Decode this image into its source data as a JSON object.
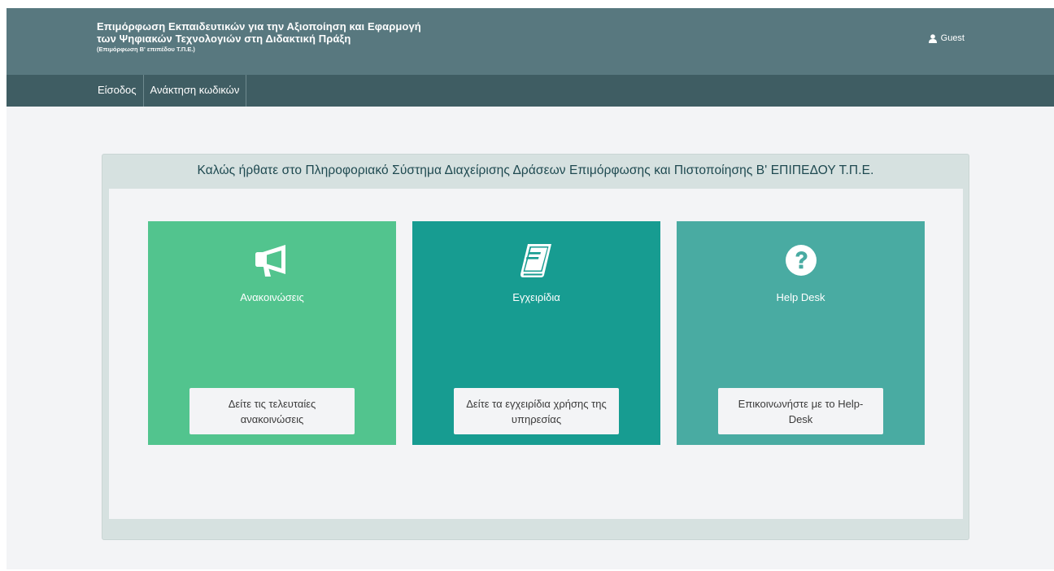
{
  "header": {
    "title_line1": "Επιμόρφωση Εκπαιδευτικών για την Αξιοποίηση και Εφαρμογή",
    "title_line2": "των Ψηφιακών Τεχνολογιών στη Διδακτική Πράξη",
    "subtitle": "(Επιμόρφωση Β' επιπέδου Τ.Π.Ε.)",
    "user_icon": "user-icon",
    "user_label": "Guest"
  },
  "nav": {
    "items": [
      {
        "label": "Είσοδος"
      },
      {
        "label": "Ανάκτηση κωδικών"
      }
    ]
  },
  "panel": {
    "heading": "Καλώς ήρθατε στο Πληροφοριακό Σύστημα Διαχείρισης Δράσεων Επιμόρφωσης και Πιστοποίησης Β' ΕΠΙΠΕΔΟΥ Τ.Π.Ε."
  },
  "cards": [
    {
      "icon": "megaphone-icon",
      "title": "Ανακοινώσεις",
      "button": "Δείτε τις τελευταίες ανακοινώσεις",
      "color": "#52c48e"
    },
    {
      "icon": "book-icon",
      "title": "Εγχειρίδια",
      "button": "Δείτε τα εγχειρίδια χρήσης της υπηρεσίας",
      "color": "#179c91"
    },
    {
      "icon": "question-circle-icon",
      "title": "Help Desk",
      "button": "Επικοινωνήστε με το Help-Desk",
      "color": "#49aba2"
    }
  ]
}
